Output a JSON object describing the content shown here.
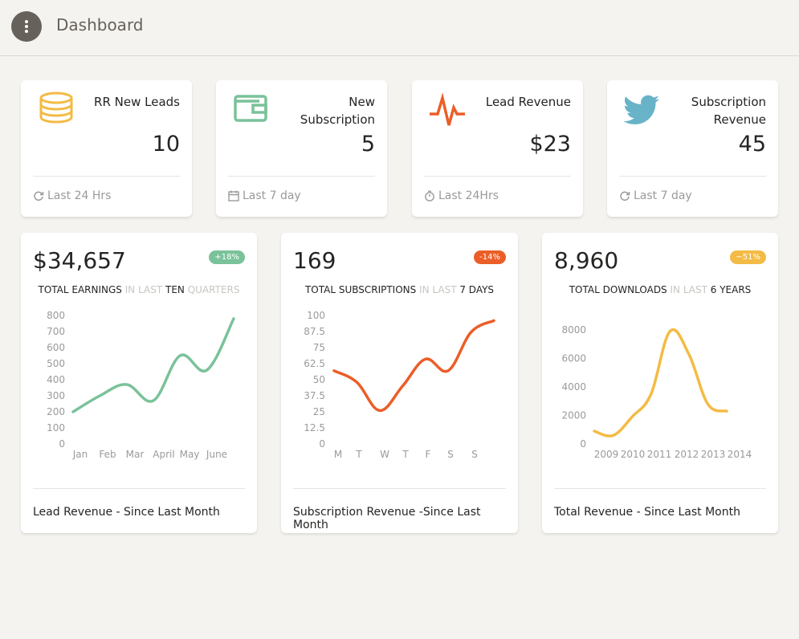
{
  "header": {
    "title": "Dashboard"
  },
  "stats": [
    {
      "label": "RR New Leads",
      "value": "10",
      "footer": "Last 24 Hrs",
      "icon": "database-icon",
      "color": "#f3bb45"
    },
    {
      "label": "New Subscription",
      "value": "5",
      "footer": "Last 7 day",
      "icon": "wallet-icon",
      "color": "#7ac29a"
    },
    {
      "label": "Lead Revenue",
      "value": "$23",
      "footer": "Last 24Hrs",
      "icon": "pulse-icon",
      "color": "#eb5e28"
    },
    {
      "label": "Subscription Revenue",
      "value": "45",
      "footer": "Last 7 day",
      "icon": "twitter-icon",
      "color": "#68b3c8"
    }
  ],
  "charts": [
    {
      "value": "$34,657",
      "badge": "+18%",
      "badge_color": "#7ac29a",
      "title_parts": [
        "TOTAL EARNINGS",
        " IN LAST ",
        "TEN",
        " QUARTERS"
      ],
      "footer": "Lead Revenue - Since Last Month"
    },
    {
      "value": "169",
      "badge": "-14%",
      "badge_color": "#eb5e28",
      "title_parts": [
        "TOTAL SUBSCRIPTIONS",
        " IN LAST ",
        "7 DAYS",
        ""
      ],
      "footer": "Subscription Revenue -Since Last Month"
    },
    {
      "value": "8,960",
      "badge": "~51%",
      "badge_color": "#f3bb45",
      "title_parts": [
        "TOTAL DOWNLOADS",
        " IN LAST ",
        "6 YEARS",
        ""
      ],
      "footer": "Total Revenue - Since Last Month"
    }
  ],
  "chart_data": [
    {
      "type": "line",
      "color": "#7ac29a",
      "categories": [
        "Jan",
        "Feb",
        "Mar",
        "April",
        "May",
        "June"
      ],
      "values": [
        200,
        300,
        370,
        270,
        550,
        460,
        780
      ],
      "yticks": [
        "800",
        "700",
        "600",
        "500",
        "400",
        "300",
        "200",
        "100",
        "0"
      ],
      "ylim": [
        0,
        800
      ]
    },
    {
      "type": "line",
      "color": "#eb5e28",
      "categories": [
        "M",
        "T",
        "W",
        "T",
        "F",
        "S",
        "S"
      ],
      "values": [
        57,
        48,
        26,
        45,
        66,
        57,
        87,
        96
      ],
      "yticks": [
        "100",
        "87.5",
        "75",
        "62.5",
        "50",
        "37.5",
        "25",
        "12.5",
        "0"
      ],
      "ylim": [
        0,
        100
      ]
    },
    {
      "type": "line",
      "color": "#f3bb45",
      "categories": [
        "2009",
        "2010",
        "2011",
        "2012",
        "2013",
        "2014"
      ],
      "values": [
        900,
        600,
        1900,
        3500,
        7900,
        6300,
        2800,
        2300
      ],
      "yticks": [
        "8000",
        "6000",
        "4000",
        "2000",
        "0"
      ],
      "ylim": [
        0,
        8000
      ]
    }
  ]
}
